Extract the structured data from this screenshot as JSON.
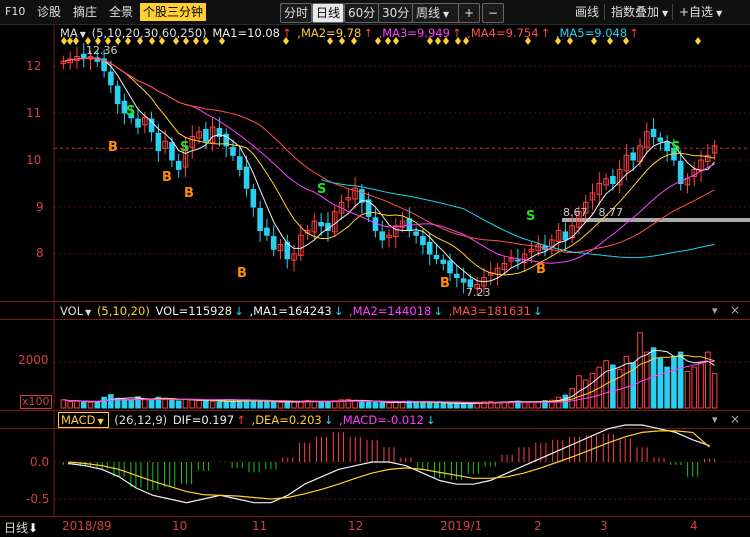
{
  "toolbar": {
    "f10": "F10",
    "diagnose": "诊股",
    "pick": "摘庄",
    "overview": "全景",
    "active_tab": "个股三分钟",
    "periods": [
      "分时",
      "日线",
      "60分",
      "30分"
    ],
    "selected_period": "日线",
    "week": "周线",
    "plus": "+",
    "minus": "−",
    "draw": "画线",
    "index_overlay": "指数叠加",
    "add_watch": "+自选"
  },
  "ma_legend": {
    "name": "MA",
    "params": "(5,10,20,30,60,250)",
    "ma1": "MA1=10.08",
    "ma2": ",MA2=9.78",
    "ma3": ",MA3=9.949",
    "ma4": ",MA4=9.754",
    "ma5": ",MA5=9.048"
  },
  "vol_legend": {
    "name": "VOL",
    "params": "(5,10,20)",
    "vol": "VOL=115928",
    "ma1": ",MA1=164243",
    "ma2": ",MA2=144018",
    "ma3": ",MA3=181631"
  },
  "macd_legend": {
    "name": "MACD",
    "params": "(26,12,9)",
    "dif": "DIF=0.197",
    "dea": ",DEA=0.203",
    "macd": ",MACD=-0.012"
  },
  "price_axis": [
    "12",
    "11",
    "10",
    "9",
    "8"
  ],
  "vol_axis": {
    "v": "2000",
    "unit": "x100"
  },
  "macd_axis": [
    "0.0",
    "-0.5"
  ],
  "annotations": {
    "high": "12.36",
    "low": "7.23",
    "range": "8.67 - 8.77"
  },
  "signals": {
    "buy": "B",
    "sell": "S"
  },
  "x_axis": [
    "2018/8",
    "9",
    "10",
    "11",
    "12",
    "2019/1",
    "2",
    "3",
    "4"
  ],
  "period_label": "日线",
  "colors": {
    "up": "#ff4040",
    "down": "#2ad0f0",
    "accent": "#ffcf33"
  },
  "chart_data": {
    "type": "candlestick",
    "closes": [
      12.1,
      12.15,
      12.2,
      12.18,
      12.2,
      12.1,
      11.9,
      11.6,
      11.2,
      11.0,
      10.9,
      10.7,
      10.9,
      10.6,
      10.2,
      10.4,
      10.0,
      9.8,
      10.3,
      10.5,
      10.6,
      10.4,
      10.7,
      10.5,
      10.3,
      10.1,
      9.8,
      9.4,
      9.0,
      8.5,
      8.4,
      8.1,
      8.2,
      7.9,
      8.0,
      8.4,
      8.5,
      8.7,
      8.6,
      8.5,
      8.9,
      9.1,
      9.2,
      9.4,
      9.1,
      8.8,
      8.5,
      8.3,
      8.4,
      8.6,
      8.7,
      8.5,
      8.4,
      8.2,
      8.0,
      7.9,
      7.8,
      7.6,
      7.5,
      7.4,
      7.3,
      7.35,
      7.5,
      7.6,
      7.7,
      7.8,
      7.9,
      7.85,
      8.0,
      8.1,
      8.2,
      8.1,
      8.3,
      8.5,
      8.3,
      8.6,
      8.9,
      9.1,
      9.3,
      9.5,
      9.6,
      9.5,
      9.8,
      10.1,
      10.0,
      10.3,
      10.6,
      10.5,
      10.4,
      10.2,
      10.0,
      9.5,
      9.6,
      9.8,
      10.0,
      10.1,
      10.3
    ],
    "volume": [
      380,
      300,
      320,
      280,
      260,
      300,
      500,
      620,
      450,
      400,
      380,
      520,
      400,
      360,
      500,
      420,
      360,
      330,
      400,
      380,
      350,
      330,
      300,
      280,
      300,
      320,
      360,
      380,
      340,
      300,
      280,
      320,
      260,
      250,
      280,
      300,
      350,
      320,
      300,
      280,
      330,
      380,
      400,
      360,
      300,
      280,
      260,
      250,
      240,
      260,
      300,
      320,
      280,
      260,
      250,
      230,
      220,
      210,
      200,
      190,
      220,
      260,
      280,
      300,
      260,
      280,
      300,
      320,
      280,
      260,
      300,
      340,
      360,
      500,
      600,
      900,
      1500,
      1300,
      1600,
      1900,
      2200,
      2000,
      1800,
      2400,
      2100,
      3500,
      2600,
      2800,
      2300,
      1900,
      2400,
      2600,
      1700,
      1900,
      2100,
      2600,
      1600
    ],
    "macd": {
      "dif": [
        -0.02,
        -0.05,
        -0.1,
        -0.2,
        -0.35,
        -0.45,
        -0.5,
        -0.55,
        -0.5,
        -0.45,
        -0.5,
        -0.55,
        -0.55,
        -0.45,
        -0.3,
        -0.2,
        -0.1,
        -0.05,
        0.0,
        0.0,
        -0.05,
        -0.15,
        -0.25,
        -0.3,
        -0.3,
        -0.25,
        -0.15,
        -0.05,
        0.05,
        0.15,
        0.25,
        0.35,
        0.45,
        0.5,
        0.5,
        0.45,
        0.4,
        0.3,
        0.22
      ],
      "dea": [
        0.0,
        -0.02,
        -0.05,
        -0.1,
        -0.18,
        -0.26,
        -0.33,
        -0.4,
        -0.44,
        -0.45,
        -0.46,
        -0.48,
        -0.5,
        -0.48,
        -0.43,
        -0.37,
        -0.3,
        -0.22,
        -0.15,
        -0.1,
        -0.08,
        -0.1,
        -0.14,
        -0.18,
        -0.22,
        -0.22,
        -0.2,
        -0.15,
        -0.08,
        0.0,
        0.08,
        0.17,
        0.26,
        0.34,
        0.4,
        0.42,
        0.42,
        0.4,
        0.2
      ]
    }
  }
}
